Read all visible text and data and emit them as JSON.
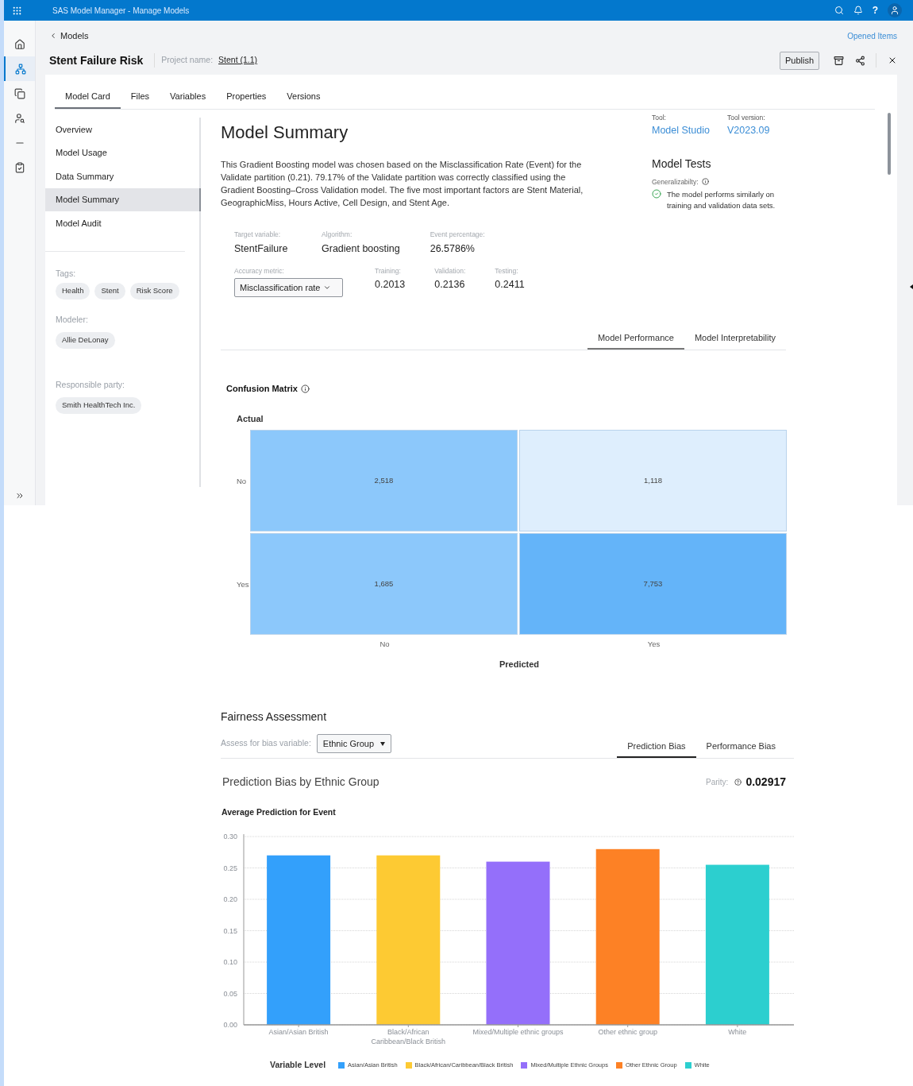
{
  "app_bar": {
    "title": "SAS Model Manager - Manage Models",
    "help": "?"
  },
  "breadcrumb": "Models",
  "opened_items": "Opened Items",
  "model": {
    "name": "Stent Failure Risk",
    "project_label": "Project name:",
    "project": "Stent (1.1)"
  },
  "publish": "Publish",
  "tabs": [
    {
      "label": "Model Card",
      "selected": true
    },
    {
      "label": "Files",
      "selected": false
    },
    {
      "label": "Variables",
      "selected": false
    },
    {
      "label": "Properties",
      "selected": false
    },
    {
      "label": "Versions",
      "selected": false
    }
  ],
  "nav": {
    "items": [
      {
        "label": "Overview",
        "selected": false
      },
      {
        "label": "Model Usage",
        "selected": false
      },
      {
        "label": "Data Summary",
        "selected": false
      },
      {
        "label": "Model Summary",
        "selected": true
      },
      {
        "label": "Model Audit",
        "selected": false
      }
    ],
    "tags_label": "Tags:",
    "tags": [
      "Health",
      "Stent",
      "Risk Score"
    ],
    "modeler_label": "Modeler:",
    "modeler": "Allie DeLonay",
    "responsible_label": "Responsible party:",
    "responsible": "Smith HealthTech Inc."
  },
  "summary": {
    "title": "Model Summary",
    "text": "This Gradient Boosting model was chosen based on the Misclassification Rate (Event) for the Validate partition (0.21). 79.17% of the Validate partition was correctly classified using the Gradient Boosting–Cross Validation model. The five most important factors are Stent Material, GeographicMiss, Hours Active, Cell Design, and Stent Age.",
    "tool_label": "Tool:",
    "tool": "Model Studio",
    "version_label": "Tool version:",
    "version": "V2023.09",
    "tests_title": "Model Tests",
    "test_label": "Generalizabilty:",
    "test_passed": true,
    "test_text": "The model performs similarly on training and validation data sets."
  },
  "facts": [
    {
      "label": "Target variable:",
      "value": "StentFailure"
    },
    {
      "label": "Algorithm:",
      "value": "Gradient boosting"
    },
    {
      "label": "Event percentage:",
      "value": "26.5786%"
    }
  ],
  "accuracy": {
    "label": "Accuracy metric:",
    "value": "Misclassification rate"
  },
  "scores": [
    {
      "label": "Training:",
      "value": "0.2013"
    },
    {
      "label": "Validation:",
      "value": "0.2136"
    },
    {
      "label": "Testing:",
      "value": "0.2411"
    }
  ],
  "performance_tabs": [
    {
      "label": "Model Performance",
      "selected": true
    },
    {
      "label": "Model Interpretability",
      "selected": false
    }
  ],
  "confusion_matrix": {
    "title": "Confusion Matrix",
    "y_label": "Actual",
    "x_label": "Predicted",
    "rows": [
      {
        "label": "No",
        "cells": [
          {
            "value": "2,518",
            "color": "#8cc8fb"
          },
          {
            "value": "1,118",
            "color": "#deeefd"
          }
        ]
      },
      {
        "label": "Yes",
        "cells": [
          {
            "value": "1,685",
            "color": "#8cc8fb"
          },
          {
            "value": "7,753",
            "color": "#64b4f9"
          }
        ]
      }
    ],
    "predicted_labels": [
      "No",
      "Yes"
    ]
  },
  "fairness": {
    "title": "Fairness Assessment",
    "bias_label": "Assess for bias variable:",
    "bias_variable": "Ethnic Group",
    "tabs": [
      {
        "label": "Prediction Bias",
        "selected": true
      },
      {
        "label": "Performance Bias",
        "selected": false
      }
    ],
    "chart_heading": "Prediction Bias by Ethnic Group",
    "parity_label": "Parity:",
    "parity": "0.02917",
    "chart_data": {
      "type": "bar",
      "title": "Average Prediction for Event",
      "grid": true,
      "legend": {
        "title": "Variable Level"
      },
      "categories": [
        "Asian/Asian British",
        "Black/African Caribbean/Black British",
        "Mixed/Multiple ethnic groups",
        "Other ethnic group",
        "White"
      ],
      "ylim": [
        0,
        0.3
      ],
      "yticks": [
        {
          "value": 0,
          "label": "0.00"
        },
        {
          "value": 0.05,
          "label": "0.05"
        },
        {
          "value": 0.1,
          "label": "0.10"
        },
        {
          "value": 0.15,
          "label": "0.15"
        },
        {
          "value": 0.2,
          "label": "0.20"
        },
        {
          "value": 0.25,
          "label": "0.25"
        },
        {
          "value": 0.3,
          "label": "0.30"
        }
      ],
      "series": [
        {
          "name": "Asian/Asian British",
          "color": "#33a0fb",
          "values": [
            0.27,
            null,
            null,
            null,
            null
          ]
        },
        {
          "name": "Black/African/Caribbean/Black British",
          "color": "#fdca33",
          "values": [
            null,
            0.27,
            null,
            null,
            null
          ]
        },
        {
          "name": "Mixed/Multiple Ethnic Groups",
          "color": "#946ffa",
          "values": [
            null,
            null,
            0.26,
            null,
            null
          ]
        },
        {
          "name": "Other Ethnic Group",
          "color": "#fd8125",
          "values": [
            null,
            null,
            null,
            0.28,
            null
          ]
        },
        {
          "name": "White",
          "color": "#2ccfcf",
          "values": [
            null,
            null,
            null,
            null,
            0.255
          ]
        }
      ]
    }
  }
}
